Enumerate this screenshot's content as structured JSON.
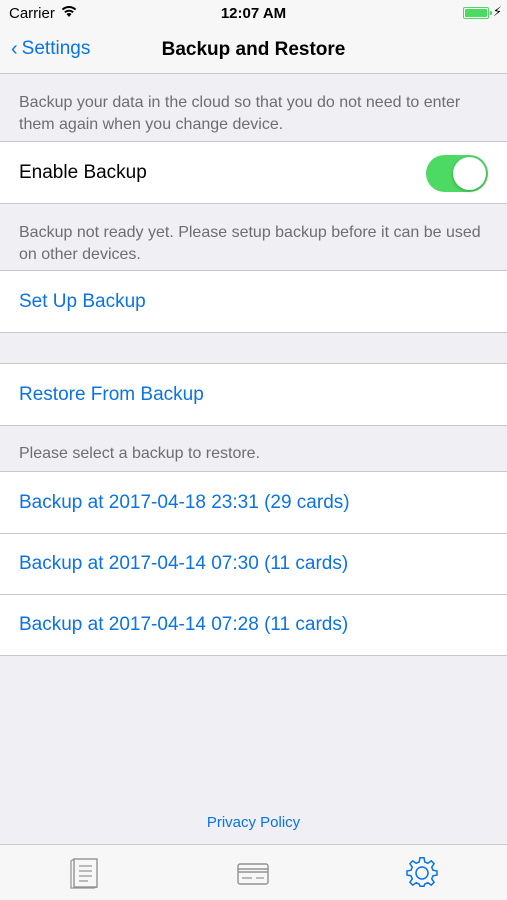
{
  "status_bar": {
    "carrier": "Carrier",
    "time": "12:07 AM"
  },
  "nav": {
    "back_label": "Settings",
    "title": "Backup and Restore"
  },
  "backup_section": {
    "description": "Backup your data in the cloud so that you do not need to enter them again when you change device.",
    "enable_label": "Enable Backup",
    "enable_on": true,
    "status_note": "Backup not ready yet. Please setup backup before it can be used on other devices.",
    "setup_label": "Set Up Backup"
  },
  "restore_section": {
    "restore_label": "Restore From Backup",
    "select_note": "Please select a backup to restore.",
    "backups": [
      {
        "label": "Backup at 2017-04-18 23:31 (29 cards)"
      },
      {
        "label": "Backup at 2017-04-14 07:30 (11 cards)"
      },
      {
        "label": "Backup at 2017-04-14 07:28 (11 cards)"
      }
    ]
  },
  "footer": {
    "privacy_label": "Privacy Policy"
  },
  "tab_bar": {
    "tabs": [
      {
        "icon": "document-icon",
        "active": false
      },
      {
        "icon": "card-icon",
        "active": false
      },
      {
        "icon": "gear-icon",
        "active": true
      }
    ]
  },
  "colors": {
    "accent": "#0a73e6",
    "toggle_on": "#4cd964",
    "background": "#efeff4"
  }
}
